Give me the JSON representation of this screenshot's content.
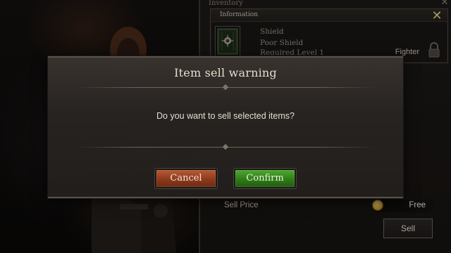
{
  "inventory": {
    "title": "Inventory",
    "information": {
      "header": "Information",
      "item_name": "Shield",
      "item_grade": "Poor Shield",
      "required_level": "Required Level 1",
      "class": "Fighter"
    },
    "sell_price_label": "Sell Price",
    "sell_price_value": "Free",
    "sell_button": "Sell"
  },
  "dialog": {
    "title": "Item sell warning",
    "message": "Do you want to sell selected items?",
    "cancel_label": "Cancel",
    "confirm_label": "Confirm"
  },
  "colors": {
    "cancel_button": "#9c4525",
    "confirm_button": "#3a8a20",
    "close_x": "#e7d48c",
    "coin": "#d9a528"
  },
  "icons": {
    "close": "close-icon",
    "lock": "lock-icon",
    "coin": "gold-coin-icon",
    "item": "shield-item-icon"
  }
}
